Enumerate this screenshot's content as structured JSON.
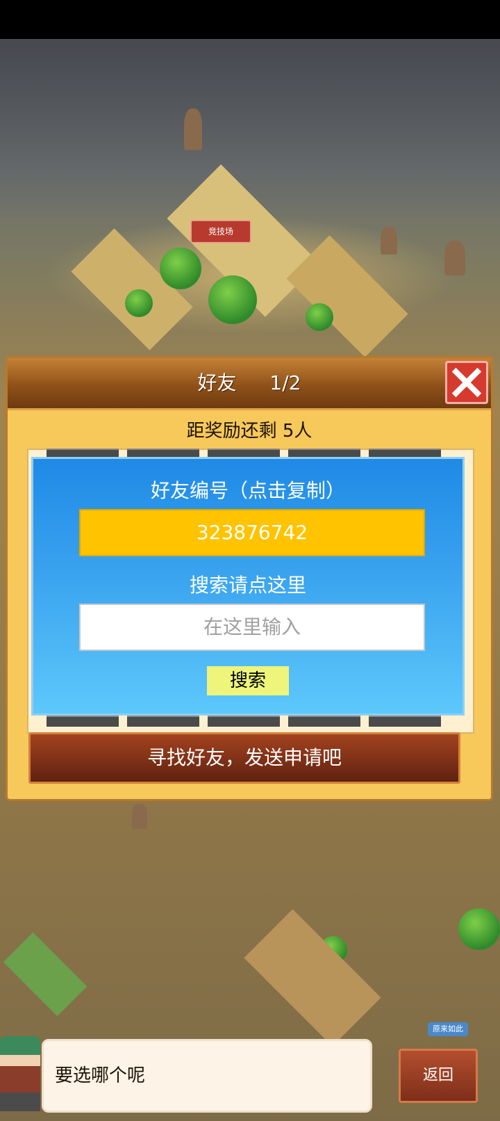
{
  "map": {
    "arena_label": "竞技场"
  },
  "dialog": {
    "title": "好友",
    "page": "1/2",
    "reward_text": "距奖励还剩 5人",
    "friend_code_label": "好友编号（点击复制）",
    "friend_code": "323876742",
    "search_hint": "搜索请点这里",
    "search_placeholder": "在这里输入",
    "search_button": "搜索",
    "send_request_button": "寻找好友，发送申请吧"
  },
  "bottom": {
    "message": "要选哪个呢",
    "badge": "原来如此",
    "back_button": "返回"
  },
  "colors": {
    "accent_yellow": "#ffc300",
    "card_blue": "#3aa3ef",
    "close_red": "#d63a2e",
    "button_brown": "#7b2f16"
  }
}
